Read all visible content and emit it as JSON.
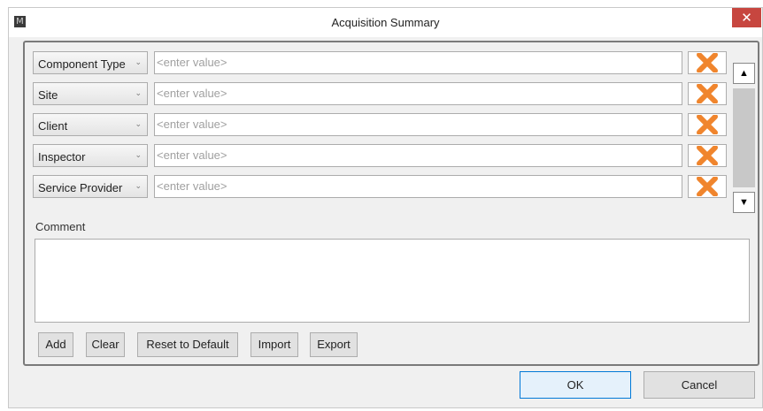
{
  "window": {
    "title": "Acquisition Summary",
    "app_icon_glyph": "M",
    "close_glyph": "✕"
  },
  "fields": [
    {
      "label": "Component Type",
      "placeholder": "<enter value>"
    },
    {
      "label": "Site",
      "placeholder": "<enter value>"
    },
    {
      "label": "Client",
      "placeholder": "<enter value>"
    },
    {
      "label": "Inspector",
      "placeholder": "<enter value>"
    },
    {
      "label": "Service Provider",
      "placeholder": "<enter value>"
    }
  ],
  "dropdown_glyph": "⌄",
  "scroll": {
    "up_glyph": "▲",
    "down_glyph": "▼"
  },
  "comment": {
    "label": "Comment",
    "value": ""
  },
  "buttons": {
    "add": "Add",
    "clear": "Clear",
    "reset": "Reset to Default",
    "import": "Import",
    "export": "Export"
  },
  "dialog": {
    "ok": "OK",
    "cancel": "Cancel"
  },
  "icons": {
    "delete": "orange-x-icon"
  },
  "colors": {
    "delete_x": "#f0852d",
    "close_button": "#c7463f",
    "ok_border": "#0078d7"
  }
}
